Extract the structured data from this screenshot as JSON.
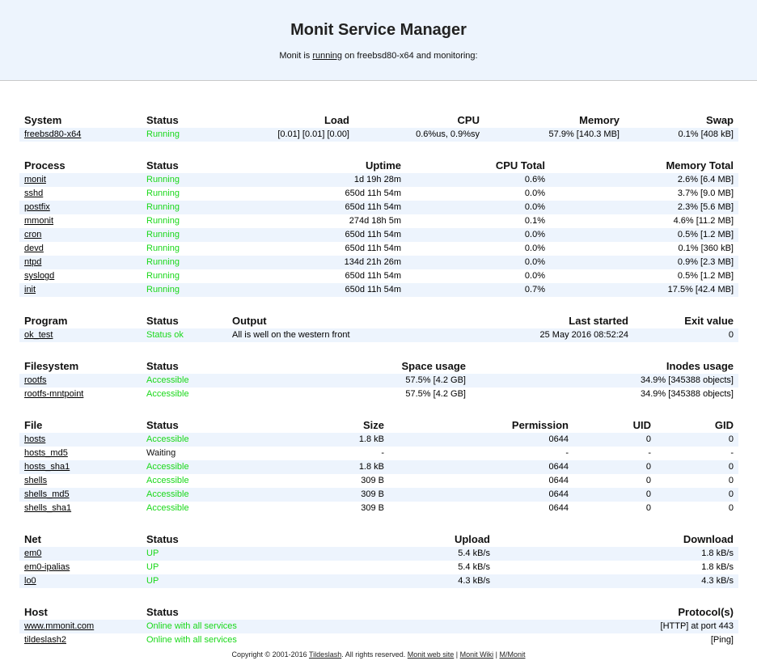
{
  "header": {
    "title": "Monit Service Manager",
    "subtitle_prefix": "Monit is ",
    "subtitle_link": "running",
    "subtitle_suffix": " on freebsd80-x64 and monitoring:"
  },
  "system": {
    "headers": [
      "System",
      "Status",
      "Load",
      "CPU",
      "Memory",
      "Swap"
    ],
    "rows": [
      {
        "name": "freebsd80-x64",
        "status": "Running",
        "load": "[0.01] [0.01] [0.00]",
        "cpu": "0.6%us, 0.9%sy",
        "memory": "57.9% [140.3 MB]",
        "swap": "0.1% [408 kB]"
      }
    ]
  },
  "process": {
    "headers": [
      "Process",
      "Status",
      "Uptime",
      "CPU Total",
      "Memory Total"
    ],
    "rows": [
      {
        "name": "monit",
        "status": "Running",
        "uptime": "1d 19h 28m",
        "cpu": "0.6%",
        "memory": "2.6% [6.4 MB]"
      },
      {
        "name": "sshd",
        "status": "Running",
        "uptime": "650d 11h 54m",
        "cpu": "0.0%",
        "memory": "3.7% [9.0 MB]"
      },
      {
        "name": "postfix",
        "status": "Running",
        "uptime": "650d 11h 54m",
        "cpu": "0.0%",
        "memory": "2.3% [5.6 MB]"
      },
      {
        "name": "mmonit",
        "status": "Running",
        "uptime": "274d 18h 5m",
        "cpu": "0.1%",
        "memory": "4.6% [11.2 MB]"
      },
      {
        "name": "cron",
        "status": "Running",
        "uptime": "650d 11h 54m",
        "cpu": "0.0%",
        "memory": "0.5% [1.2 MB]"
      },
      {
        "name": "devd",
        "status": "Running",
        "uptime": "650d 11h 54m",
        "cpu": "0.0%",
        "memory": "0.1% [360 kB]"
      },
      {
        "name": "ntpd",
        "status": "Running",
        "uptime": "134d 21h 26m",
        "cpu": "0.0%",
        "memory": "0.9% [2.3 MB]"
      },
      {
        "name": "syslogd",
        "status": "Running",
        "uptime": "650d 11h 54m",
        "cpu": "0.0%",
        "memory": "0.5% [1.2 MB]"
      },
      {
        "name": "init",
        "status": "Running",
        "uptime": "650d 11h 54m",
        "cpu": "0.7%",
        "memory": "17.5% [42.4 MB]"
      }
    ]
  },
  "program": {
    "headers": [
      "Program",
      "Status",
      "Output",
      "Last started",
      "Exit value"
    ],
    "rows": [
      {
        "name": "ok_test",
        "status": "Status ok",
        "output": "All is well on the western front",
        "last_started": "25 May 2016 08:52:24",
        "exit": "0"
      }
    ]
  },
  "filesystem": {
    "headers": [
      "Filesystem",
      "Status",
      "Space usage",
      "Inodes usage"
    ],
    "rows": [
      {
        "name": "rootfs",
        "status": "Accessible",
        "space": "57.5% [4.2 GB]",
        "inodes": "34.9% [345388 objects]"
      },
      {
        "name": "rootfs-mntpoint",
        "status": "Accessible",
        "space": "57.5% [4.2 GB]",
        "inodes": "34.9% [345388 objects]"
      }
    ]
  },
  "file": {
    "headers": [
      "File",
      "Status",
      "Size",
      "Permission",
      "UID",
      "GID"
    ],
    "rows": [
      {
        "name": "hosts",
        "status": "Accessible",
        "status_color": "green",
        "size": "1.8 kB",
        "perm": "0644",
        "uid": "0",
        "gid": "0"
      },
      {
        "name": "hosts_md5",
        "status": "Waiting",
        "status_color": "black",
        "size": "-",
        "perm": "-",
        "uid": "-",
        "gid": "-"
      },
      {
        "name": "hosts_sha1",
        "status": "Accessible",
        "status_color": "green",
        "size": "1.8 kB",
        "perm": "0644",
        "uid": "0",
        "gid": "0"
      },
      {
        "name": "shells",
        "status": "Accessible",
        "status_color": "green",
        "size": "309 B",
        "perm": "0644",
        "uid": "0",
        "gid": "0"
      },
      {
        "name": "shells_md5",
        "status": "Accessible",
        "status_color": "green",
        "size": "309 B",
        "perm": "0644",
        "uid": "0",
        "gid": "0"
      },
      {
        "name": "shells_sha1",
        "status": "Accessible",
        "status_color": "green",
        "size": "309 B",
        "perm": "0644",
        "uid": "0",
        "gid": "0"
      }
    ]
  },
  "net": {
    "headers": [
      "Net",
      "Status",
      "Upload",
      "Download"
    ],
    "rows": [
      {
        "name": "em0",
        "status": "UP",
        "upload": "5.4 kB/s",
        "download": "1.8 kB/s"
      },
      {
        "name": "em0-ipalias",
        "status": "UP",
        "upload": "5.4 kB/s",
        "download": "1.8 kB/s"
      },
      {
        "name": "lo0",
        "status": "UP",
        "upload": "4.3 kB/s",
        "download": "4.3 kB/s"
      }
    ]
  },
  "host": {
    "headers": [
      "Host",
      "Status",
      "Protocol(s)"
    ],
    "rows": [
      {
        "name": "www.mmonit.com",
        "status": "Online with all services",
        "protocols": "[HTTP] at port 443"
      },
      {
        "name": "tildeslash2",
        "status": "Online with all services",
        "protocols": "[Ping]"
      }
    ]
  },
  "footer": {
    "copyright": "Copyright © 2001-2016 ",
    "company_link": "Tildeslash",
    "rights": ". All rights reserved. ",
    "web_site": "Monit web site",
    "sep1": " | ",
    "wiki": "Monit Wiki",
    "sep2": " | ",
    "mmonit": "M/Monit"
  },
  "colors": {
    "header_bg": "#edf4fd",
    "row_alt_bg": "#edf4fd",
    "status_green": "#19d819"
  }
}
